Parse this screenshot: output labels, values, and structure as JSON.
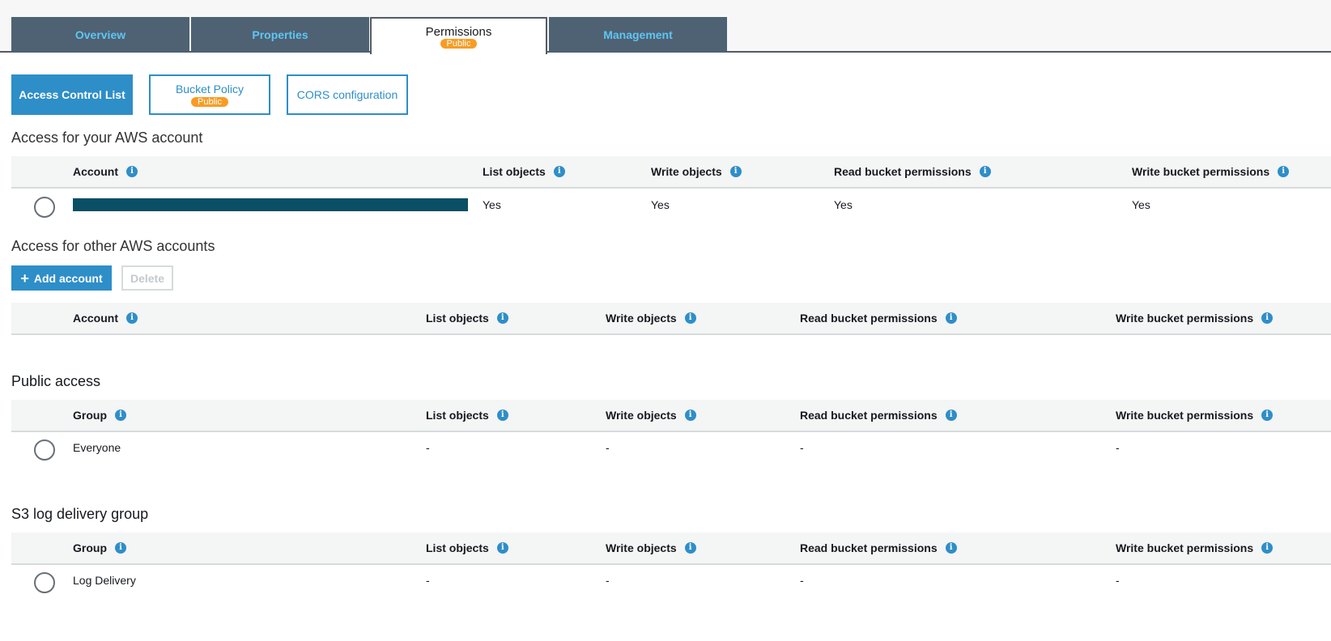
{
  "tabs": [
    {
      "label": "Overview"
    },
    {
      "label": "Properties"
    },
    {
      "label": "Permissions",
      "badge": "Public"
    },
    {
      "label": "Management"
    }
  ],
  "subtabs": {
    "acl": "Access Control List",
    "policy": "Bucket Policy",
    "policy_badge": "Public",
    "cors": "CORS configuration"
  },
  "columns": {
    "account": "Account",
    "group": "Group",
    "list": "List objects",
    "write": "Write objects",
    "read_perm": "Read bucket permissions",
    "write_perm": "Write bucket permissions",
    "info_glyph": "i"
  },
  "own_account": {
    "title": "Access for your AWS account",
    "row": {
      "list": "Yes",
      "write": "Yes",
      "read_perm": "Yes",
      "write_perm": "Yes"
    }
  },
  "other_accounts": {
    "title": "Access for other AWS accounts",
    "add_label": "Add account",
    "add_icon": "+",
    "delete_label": "Delete"
  },
  "public_access": {
    "title": "Public access",
    "row": {
      "group": "Everyone",
      "list": "-",
      "write": "-",
      "read_perm": "-",
      "write_perm": "-"
    }
  },
  "log_delivery": {
    "title": "S3 log delivery group",
    "row": {
      "group": "Log Delivery",
      "list": "-",
      "write": "-",
      "read_perm": "-",
      "write_perm": "-"
    }
  },
  "colors": {
    "tab_bg": "#4e6273",
    "tab_text": "#5fc5f3",
    "accent": "#2e8ec8",
    "badge": "#f89c24",
    "redaction": "#0a4f64"
  }
}
